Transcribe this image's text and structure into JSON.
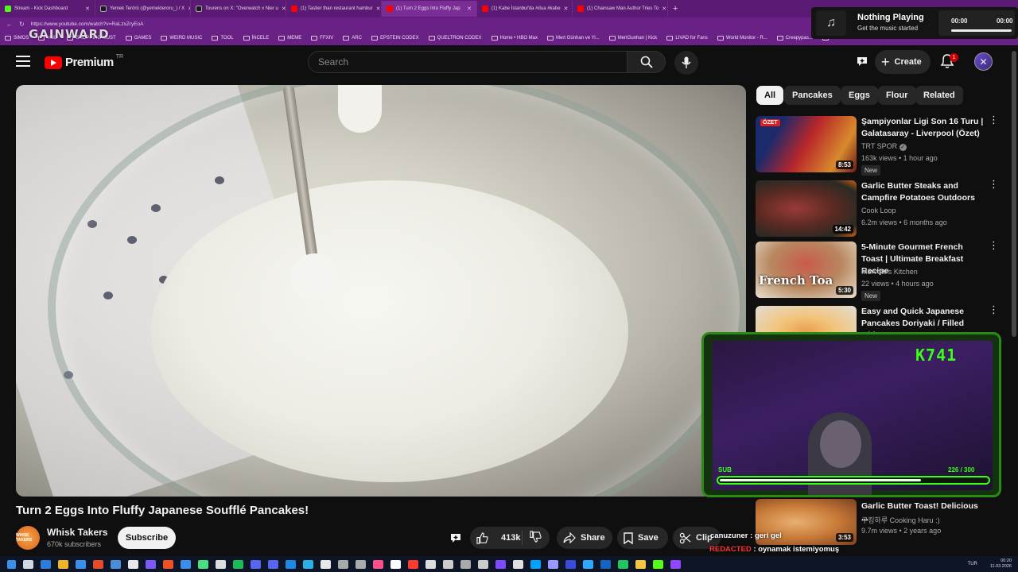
{
  "browser": {
    "tabs": [
      {
        "title": "Stream - Kick Dashboard",
        "color": "#53fc18"
      },
      {
        "title": "Yemek Terörü (@yemekteroru_) / X",
        "color": "#1a1a1a"
      },
      {
        "title": "Tourens on X: \"Overwatch x Nier u",
        "color": "#1a1a1a"
      },
      {
        "title": "(1) Tastier than restaurant hambur",
        "color": "#ff0000"
      },
      {
        "title": "(1) Turn 2 Eggs Into Fluffy Jap",
        "color": "#ff0000",
        "active": true
      },
      {
        "title": "(1) Kabe İstanbul'da #dua #kabe",
        "color": "#ff0000"
      },
      {
        "title": "(1) Chainsaw Man Author Tries To",
        "color": "#ff0000"
      }
    ],
    "new_tab": "+",
    "url": "https://www.youtube.com/watch?v=RaLzxZryEoA",
    "bookmarks": [
      "SIMOS",
      "HUD",
      "SHOPPING MUST",
      "GAMES",
      "WEIRD MUSIC",
      "TOOL",
      "İNCELE",
      "MEME",
      "FFXIV",
      "ARC",
      "EPSTEIN CODEX",
      "QUELTRON CODEX",
      "Home • HBO Max",
      "Mert Günhan ve Yi...",
      "MertGunhan | Kick",
      "LIVAD for Fans",
      "World Monitor - R...",
      "Creepypas...",
      "Ghost Rider - Rebo..."
    ]
  },
  "overlay_logo": "GAINWARD",
  "now_playing": {
    "icon": "music-note-icon",
    "title": "Nothing Playing",
    "subtitle": "Get the music started",
    "time_start": "00:00",
    "time_end": "00:00"
  },
  "header": {
    "logo_text": "Premium",
    "country": "TR",
    "search_placeholder": "Search",
    "create_label": "Create",
    "notification_count": "1"
  },
  "video": {
    "title": "Turn 2 Eggs Into Fluffy Japanese Soufflé Pancakes!",
    "channel": "Whisk Takers",
    "channel_avatar_text": "WHISK TAKERS",
    "subscribers": "670k subscribers",
    "subscribe_label": "Subscribe",
    "likes": "413k",
    "share_label": "Share",
    "save_label": "Save",
    "clip_label": "Clip"
  },
  "chips": [
    "All",
    "Pancakes",
    "Eggs",
    "Flour",
    "Related"
  ],
  "related": [
    {
      "title": "Şampiyonlar Ligi Son 16 Turu | Galatasaray - Liverpool (Özet)",
      "channel": "TRT SPOR",
      "verified": true,
      "meta": "163k views • 1 hour ago",
      "badge": "New",
      "duration": "8:53",
      "thumb_text": "ÖZET"
    },
    {
      "title": "Garlic Butter Steaks and Campfire Potatoes Outdoors",
      "channel": "Cook Loop",
      "meta": "6.2m views • 6 months ago",
      "duration": "14:42"
    },
    {
      "title": "5-Minute Gourmet French Toast | Ultimate Breakfast Recipe",
      "channel": "Mervotti's Kitchen",
      "meta": "22 views • 4 hours ago",
      "badge": "New",
      "duration": "5:30",
      "thumb_text": "French Toa"
    },
    {
      "title": "Easy and Quick Japanese Pancakes Doriyaki / Filled with...",
      "channel": "",
      "meta": "",
      "duration": ""
    },
    {
      "title": "Garlic Butter Toast! Delicious ...",
      "channel": "쿠킹하루 Cooking Haru :)",
      "meta": "9.7m views • 2 years ago",
      "duration": "3:53"
    }
  ],
  "stream": {
    "viewer_count": "K741",
    "sub_label": "SUB",
    "sub_count": "226 / 300",
    "sub_progress": 0.753
  },
  "chat": {
    "line1": "canuzuner : geri gel",
    "line2_name": "REDACTED",
    "line2_text": ": oynamak istemiyomuş"
  },
  "taskbar": {
    "lang": "TUR",
    "time": "00:20",
    "date": "11.03.2026"
  }
}
